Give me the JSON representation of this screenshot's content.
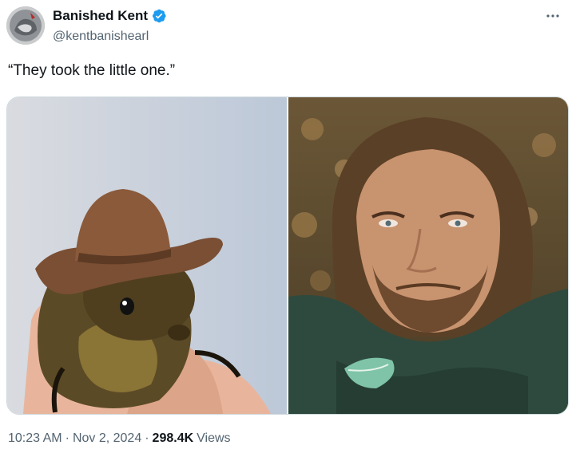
{
  "author": {
    "display_name": "Banished Kent",
    "handle": "@kentbanishearl",
    "verified": true,
    "verified_color": "#1d9bf0"
  },
  "tweet": {
    "text": "“They took the little one.”"
  },
  "media": {
    "images": [
      {
        "subject": "squirrel-cowboy-hat"
      },
      {
        "subject": "man-lying-on-leaves"
      }
    ]
  },
  "meta": {
    "time": "10:23 AM",
    "separator1": "·",
    "date": "Nov 2, 2024",
    "separator2": "·",
    "views_count": "298.4K",
    "views_label": "Views"
  },
  "colors": {
    "text_primary": "#0f1419",
    "text_secondary": "#536471",
    "border": "#cfd9de"
  }
}
